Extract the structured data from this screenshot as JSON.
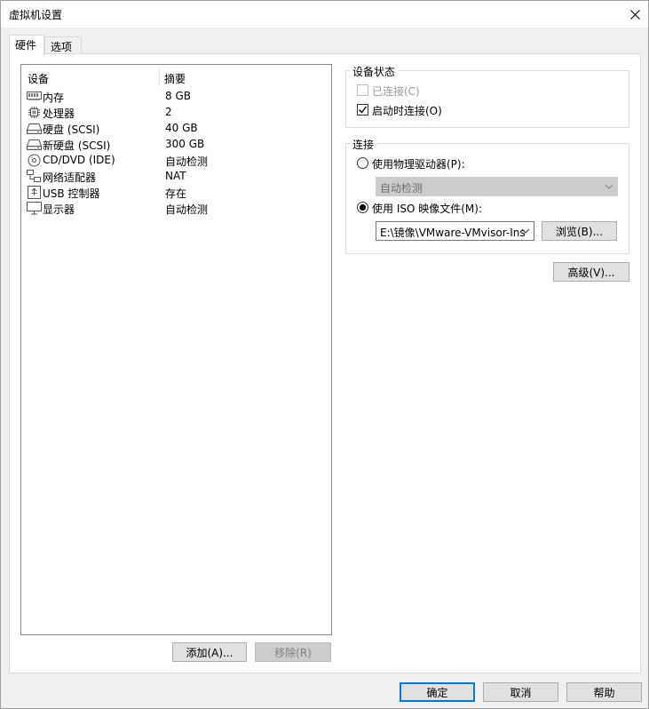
{
  "window": {
    "title": "虚拟机设置"
  },
  "tabs": [
    {
      "label": "硬件",
      "active": true
    },
    {
      "label": "选项",
      "active": false
    }
  ],
  "device_list": {
    "headers": {
      "device": "设备",
      "summary": "摘要"
    },
    "rows": [
      {
        "icon": "memory-icon",
        "name": "内存",
        "summary": "8 GB"
      },
      {
        "icon": "cpu-icon",
        "name": "处理器",
        "summary": "2"
      },
      {
        "icon": "hard-disk-icon",
        "name": "硬盘 (SCSI)",
        "summary": "40 GB"
      },
      {
        "icon": "hard-disk-icon",
        "name": "新硬盘 (SCSI)",
        "summary": "300 GB"
      },
      {
        "icon": "cd-dvd-icon",
        "name": "CD/DVD (IDE)",
        "summary": "自动检测",
        "selected": true
      },
      {
        "icon": "network-adapter-icon",
        "name": "网络适配器",
        "summary": "NAT"
      },
      {
        "icon": "usb-icon",
        "name": "USB 控制器",
        "summary": "存在"
      },
      {
        "icon": "monitor-icon",
        "name": "显示器",
        "summary": "自动检测"
      }
    ]
  },
  "list_buttons": {
    "add": "添加(A)...",
    "remove": "移除(R)"
  },
  "device_status": {
    "title": "设备状态",
    "connected": {
      "label": "已连接(C)",
      "checked": false,
      "disabled": true
    },
    "connect_at_power_on": {
      "label": "启动时连接(O)",
      "checked": true
    }
  },
  "connection": {
    "title": "连接",
    "physical": {
      "label": "使用物理驱动器(P):",
      "selected": false,
      "drive_value": "自动检测"
    },
    "iso": {
      "label": "使用 ISO 映像文件(M):",
      "selected": true,
      "path_value": "E:\\镜像\\VMware-VMvisor-Ins"
    },
    "browse": "浏览(B)..."
  },
  "advanced": "高级(V)...",
  "footer": {
    "ok": "确定",
    "cancel": "取消",
    "help": "帮助"
  }
}
